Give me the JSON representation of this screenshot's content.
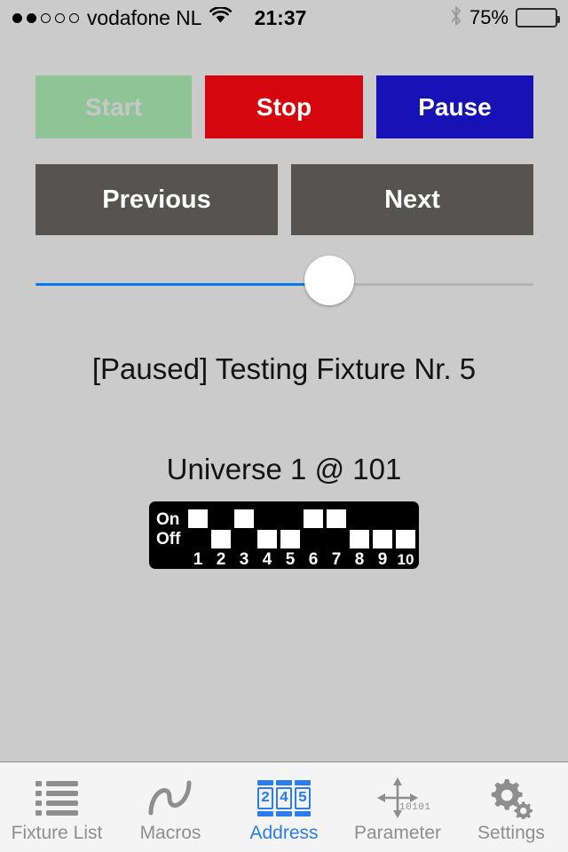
{
  "status_bar": {
    "signal_dots": {
      "filled": 2,
      "total": 5
    },
    "carrier": "vodafone NL",
    "wifi_icon": "wifi-icon",
    "time": "21:37",
    "bluetooth_icon": "bluetooth-icon",
    "battery_percent": "75%",
    "battery_level": 75
  },
  "transport": {
    "start_label": "Start",
    "start_enabled": false,
    "start_color": "#8fc596",
    "start_text_color": "#c7c7c7",
    "stop_label": "Stop",
    "stop_color": "#d6060f",
    "pause_label": "Pause",
    "pause_color": "#1612b6"
  },
  "navigation": {
    "previous_label": "Previous",
    "next_label": "Next",
    "button_color": "#555453"
  },
  "slider": {
    "value_percent": 59,
    "fill_color": "#0a78ef",
    "track_color": "#b4b4b4",
    "thumb_color": "#ffffff"
  },
  "status_text": "[Paused] Testing Fixture Nr. 5",
  "universe_text": "Universe 1 @ 101",
  "dip_switch": {
    "on_label": "On",
    "off_label": "Off",
    "background": "#000000",
    "switches": [
      {
        "number": "1",
        "state": "on"
      },
      {
        "number": "2",
        "state": "off"
      },
      {
        "number": "3",
        "state": "on"
      },
      {
        "number": "4",
        "state": "off"
      },
      {
        "number": "5",
        "state": "off"
      },
      {
        "number": "6",
        "state": "on"
      },
      {
        "number": "7",
        "state": "on"
      },
      {
        "number": "8",
        "state": "off"
      },
      {
        "number": "9",
        "state": "off"
      },
      {
        "number": "10",
        "state": "off"
      }
    ]
  },
  "tabbar": {
    "active_color": "#2a7df0",
    "inactive_color": "#8e8e8e",
    "tabs": [
      {
        "label": "Fixture List",
        "icon": "bulleted-list-icon",
        "active": false
      },
      {
        "label": "Macros",
        "icon": "sine-wave-icon",
        "active": false
      },
      {
        "label": "Address",
        "icon": "dmx-address-digits-icon",
        "active": true,
        "digits": [
          "2",
          "4",
          "5"
        ]
      },
      {
        "label": "Parameter",
        "icon": "four-way-arrows-icon",
        "active": false,
        "binary": "10101"
      },
      {
        "label": "Settings",
        "icon": "gears-icon",
        "active": false
      }
    ]
  }
}
